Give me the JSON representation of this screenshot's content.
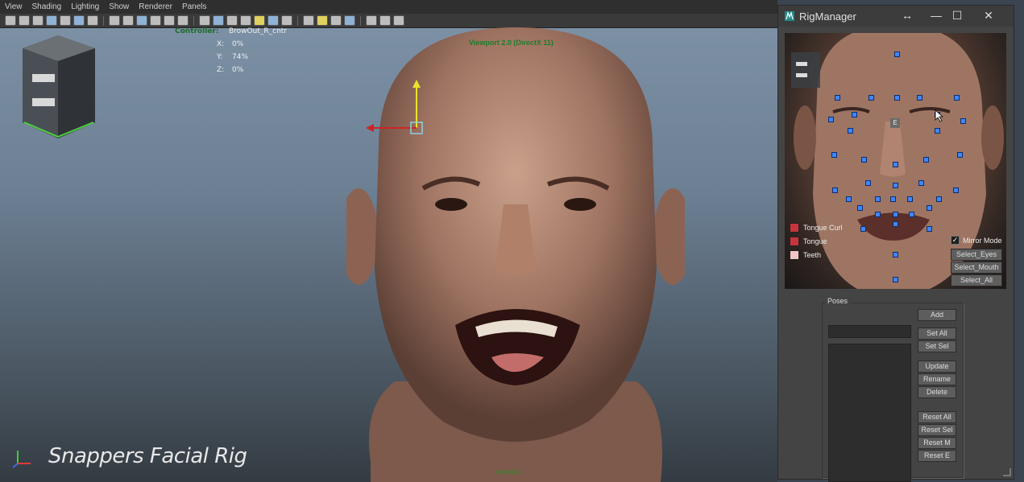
{
  "menu": [
    "View",
    "Shading",
    "Lighting",
    "Show",
    "Renderer",
    "Panels"
  ],
  "viewport": {
    "title": "Viewport 2.0 (DirectX 11)",
    "controller_label": "Controller:",
    "controller_value": "BrowOut_R_cntr",
    "x_label": "X:",
    "x_value": "0%",
    "y_label": "Y:",
    "y_value": "74%",
    "z_label": "Z:",
    "z_value": "0%",
    "camera": "camera1",
    "brand": "Snappers Facial Rig"
  },
  "rig": {
    "title": "RigManager",
    "layers": [
      {
        "label": "Tongue Curl",
        "color": "#c8343c"
      },
      {
        "label": "Tongue",
        "color": "#c8343c"
      },
      {
        "label": "Teeth",
        "color": "#f2c4c4"
      }
    ],
    "mirror_label": "Mirror Mode",
    "select_buttons": [
      "Select_Eyes",
      "Select_Mouth",
      "Select_All"
    ],
    "poses_label": "Poses",
    "pose_buttons": {
      "add": "Add",
      "set_all": "Set All",
      "set_sel": "Set Sel",
      "update": "Update",
      "rename": "Rename",
      "delete": "Delete",
      "reset_all": "Reset All",
      "reset_sel": "Reset Sel",
      "reset_m": "Reset M",
      "reset_e": "Reset E"
    },
    "e_marker": "E"
  },
  "colors": {
    "control_blue": "#3f86ff",
    "hud_green": "#1d7d2a"
  }
}
